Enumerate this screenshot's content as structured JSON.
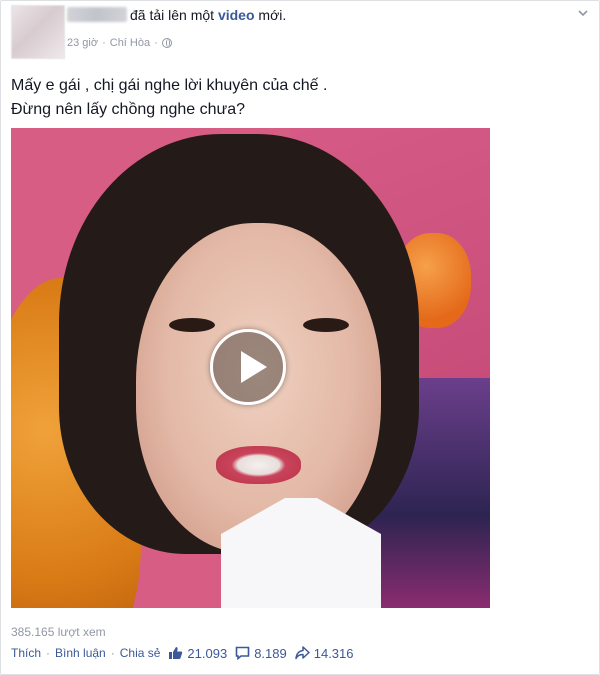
{
  "post": {
    "action_text": "đã tải lên một",
    "action_type": "video",
    "action_suffix": "mới.",
    "time": "23 giờ",
    "separator": "·",
    "location": "Chí Hòa",
    "text_line1": "Mấy e gái , chị gái nghe lời khuyên của chế .",
    "text_line2": "Đừng nên lấy chồng nghe chưa?",
    "views": "385.165 lượt xem"
  },
  "actions": {
    "like": "Thích",
    "comment": "Bình luận",
    "share": "Chia sẻ",
    "dot": "·"
  },
  "stats": {
    "likes": "21.093",
    "comments": "8.189",
    "shares": "14.316"
  },
  "icons": {
    "header": [
      "globe-icon",
      "chevron-down-icon"
    ],
    "video": [
      "play-icon"
    ],
    "stats": [
      "thumbs-up-icon",
      "comment-bubble-icon",
      "share-arrow-icon"
    ]
  },
  "colors": {
    "link": "#3b5998",
    "meta": "#9197a3",
    "text": "#141823"
  }
}
